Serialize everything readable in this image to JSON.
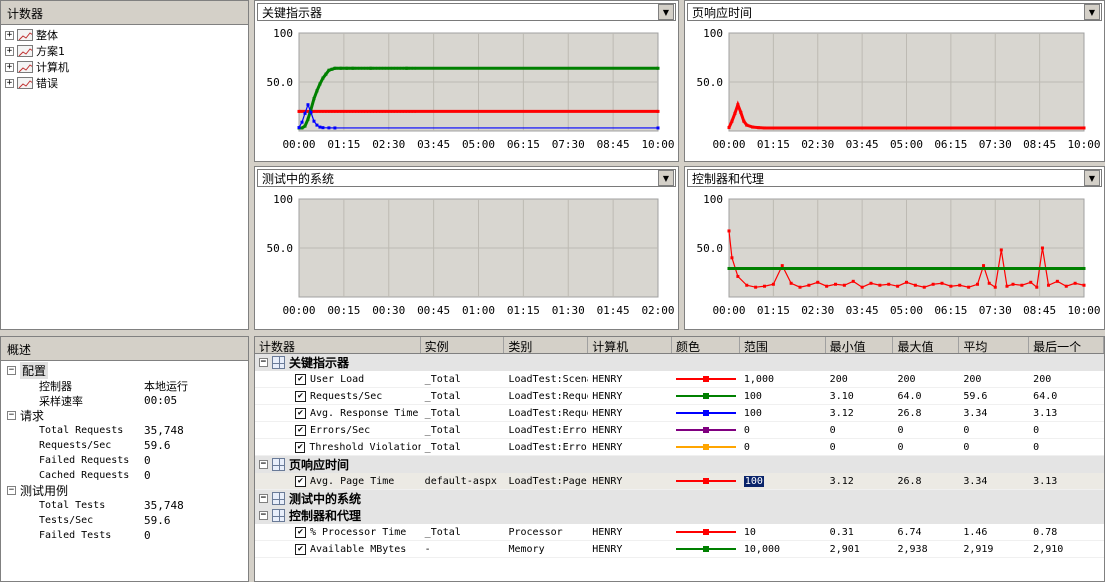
{
  "counters_panel": {
    "title": "计数器",
    "items": [
      {
        "label": "整体"
      },
      {
        "label": "方案1"
      },
      {
        "label": "计算机"
      },
      {
        "label": "错误"
      }
    ]
  },
  "summary_panel": {
    "title": "概述",
    "sections": [
      {
        "label": "配置",
        "rows": [
          {
            "key": "控制器",
            "value": "本地运行"
          },
          {
            "key": "采样速率",
            "value": "00:05"
          }
        ]
      },
      {
        "label": "请求",
        "rows": [
          {
            "key": "Total Requests",
            "value": "35,748"
          },
          {
            "key": "Requests/Sec",
            "value": "59.6"
          },
          {
            "key": "Failed Requests",
            "value": "0"
          },
          {
            "key": "Cached Requests",
            "value": "0"
          }
        ]
      },
      {
        "label": "测试用例",
        "rows": [
          {
            "key": "Total Tests",
            "value": "35,748"
          },
          {
            "key": "Tests/Sec",
            "value": "59.6"
          },
          {
            "key": "Failed Tests",
            "value": "0"
          }
        ]
      }
    ]
  },
  "graphs": [
    {
      "selector": "关键指示器",
      "y_ticks": [
        "100",
        "50.0"
      ],
      "x_ticks": [
        "00:00",
        "01:15",
        "02:30",
        "03:45",
        "05:00",
        "06:15",
        "07:30",
        "08:45",
        "10:00"
      ]
    },
    {
      "selector": "页响应时间",
      "y_ticks": [
        "100",
        "50.0"
      ],
      "x_ticks": [
        "00:00",
        "01:15",
        "02:30",
        "03:45",
        "05:00",
        "06:15",
        "07:30",
        "08:45",
        "10:00"
      ]
    },
    {
      "selector": "测试中的系统",
      "y_ticks": [
        "100",
        "50.0"
      ],
      "x_ticks": [
        "00:00",
        "00:15",
        "00:30",
        "00:45",
        "01:00",
        "01:15",
        "01:30",
        "01:45",
        "02:00"
      ]
    },
    {
      "selector": "控制器和代理",
      "y_ticks": [
        "100",
        "50.0"
      ],
      "x_ticks": [
        "00:00",
        "01:15",
        "02:30",
        "03:45",
        "05:00",
        "06:15",
        "07:30",
        "08:45",
        "10:00"
      ]
    }
  ],
  "chart_data": [
    {
      "type": "line",
      "title": "关键指示器",
      "ylim": [
        0,
        100
      ],
      "x_unit": "minutes",
      "series": [
        {
          "name": "User Load",
          "color": "#ff0000",
          "x": [
            0,
            10
          ],
          "values": [
            20,
            20
          ]
        },
        {
          "name": "Requests/Sec",
          "color": "#008000",
          "x": [
            0,
            0.083,
            0.167,
            0.25,
            0.333,
            0.417,
            0.5,
            0.583,
            0.667,
            0.75,
            0.833,
            0.917,
            1.0,
            1.167,
            1.333,
            1.5,
            2.0,
            3.0,
            10.0
          ],
          "values": [
            3.1,
            3.1,
            5,
            12,
            22,
            33,
            41,
            48,
            54,
            58,
            62,
            63,
            64,
            64,
            64,
            64,
            64,
            64,
            64
          ]
        },
        {
          "name": "Avg. Response Time",
          "color": "#0000ff",
          "x": [
            0,
            0.083,
            0.167,
            0.25,
            0.333,
            0.417,
            0.5,
            0.583,
            0.667,
            0.833,
            1.0,
            10.0
          ],
          "values": [
            3.5,
            9,
            18,
            26.8,
            19,
            10,
            6,
            4,
            3.4,
            3.2,
            3.1,
            3.1
          ]
        }
      ]
    },
    {
      "type": "line",
      "title": "页响应时间",
      "ylim": [
        0,
        100
      ],
      "x_unit": "minutes",
      "series": [
        {
          "name": "Avg. Page Time",
          "color": "#ff0000",
          "x": [
            0,
            0.083,
            0.167,
            0.25,
            0.333,
            0.417,
            0.5,
            0.667,
            0.833,
            1.0,
            10.0
          ],
          "values": [
            3.5,
            10,
            18,
            26.8,
            19,
            10,
            6,
            4,
            3.4,
            3.1,
            3.1
          ]
        }
      ]
    },
    {
      "type": "line",
      "title": "测试中的系统",
      "ylim": [
        0,
        100
      ],
      "series": []
    },
    {
      "type": "line",
      "title": "控制器和代理",
      "ylim": [
        0,
        100
      ],
      "x_unit": "minutes",
      "series": [
        {
          "name": "% Processor Time",
          "color": "#ff0000",
          "x": [
            0,
            0.083,
            0.25,
            0.5,
            0.75,
            1.0,
            1.25,
            1.5,
            1.75,
            2.0,
            2.25,
            2.5,
            2.75,
            3.0,
            3.25,
            3.5,
            3.75,
            4.0,
            4.25,
            4.5,
            4.75,
            5.0,
            5.25,
            5.5,
            5.75,
            6.0,
            6.25,
            6.5,
            6.75,
            7.0,
            7.17,
            7.33,
            7.5,
            7.67,
            7.83,
            8.0,
            8.25,
            8.5,
            8.67,
            8.83,
            9.0,
            9.25,
            9.5,
            9.75,
            10.0
          ],
          "values": [
            6.74,
            4,
            2.1,
            1.2,
            1.0,
            1.1,
            1.3,
            3.2,
            1.4,
            1.0,
            1.2,
            1.5,
            1.1,
            1.3,
            1.2,
            1.6,
            1.0,
            1.4,
            1.2,
            1.3,
            1.1,
            1.5,
            1.2,
            1.0,
            1.3,
            1.4,
            1.1,
            1.2,
            1.0,
            1.3,
            3.2,
            1.4,
            1.0,
            4.8,
            1.1,
            1.3,
            1.2,
            1.5,
            1.0,
            5.0,
            1.2,
            1.6,
            1.1,
            1.4,
            1.2
          ]
        },
        {
          "name": "Available MBytes",
          "color": "#008000",
          "x": [
            0,
            10
          ],
          "values": [
            2910,
            2910
          ]
        }
      ]
    }
  ],
  "table": {
    "columns": [
      "计数器",
      "实例",
      "类别",
      "计算机",
      "颜色",
      "范围",
      "最小值",
      "最大值",
      "平均",
      "最后一个"
    ],
    "groups": [
      {
        "label": "关键指示器",
        "rows": [
          {
            "counter": "User Load",
            "instance": "_Total",
            "category": "LoadTest:Scenario",
            "computer": "HENRY",
            "color": "#ff0000",
            "range": "1,000",
            "min": "200",
            "max": "200",
            "avg": "200",
            "last": "200"
          },
          {
            "counter": "Requests/Sec",
            "instance": "_Total",
            "category": "LoadTest:Request",
            "computer": "HENRY",
            "color": "#008000",
            "range": "100",
            "min": "3.10",
            "max": "64.0",
            "avg": "59.6",
            "last": "64.0"
          },
          {
            "counter": "Avg. Response Time",
            "instance": "_Total",
            "category": "LoadTest:Request",
            "computer": "HENRY",
            "color": "#0000ff",
            "range": "100",
            "min": "3.12",
            "max": "26.8",
            "avg": "3.34",
            "last": "3.13"
          },
          {
            "counter": "Errors/Sec",
            "instance": "_Total",
            "category": "LoadTest:Errors",
            "computer": "HENRY",
            "color": "#800080",
            "range": "0",
            "min": "0",
            "max": "0",
            "avg": "0",
            "last": "0"
          },
          {
            "counter": "Threshold Violations",
            "instance": "_Total",
            "category": "LoadTest:Errors",
            "computer": "HENRY",
            "color": "#ffa500",
            "range": "0",
            "min": "0",
            "max": "0",
            "avg": "0",
            "last": "0"
          }
        ]
      },
      {
        "label": "页响应时间",
        "rows": [
          {
            "counter": "Avg. Page Time",
            "instance": "default-aspx",
            "category": "LoadTest:Page",
            "computer": "HENRY",
            "color": "#ff0000",
            "range": "100",
            "min": "3.12",
            "max": "26.8",
            "avg": "3.34",
            "last": "3.13",
            "selected": true
          }
        ]
      },
      {
        "label": "测试中的系统",
        "rows": []
      },
      {
        "label": "控制器和代理",
        "rows": [
          {
            "counter": "% Processor Time",
            "instance": "_Total",
            "category": "Processor",
            "computer": "HENRY",
            "color": "#ff0000",
            "range": "10",
            "min": "0.31",
            "max": "6.74",
            "avg": "1.46",
            "last": "0.78"
          },
          {
            "counter": "Available MBytes",
            "instance": "-",
            "category": "Memory",
            "computer": "HENRY",
            "color": "#008000",
            "range": "10,000",
            "min": "2,901",
            "max": "2,938",
            "avg": "2,919",
            "last": "2,910"
          }
        ]
      }
    ]
  }
}
